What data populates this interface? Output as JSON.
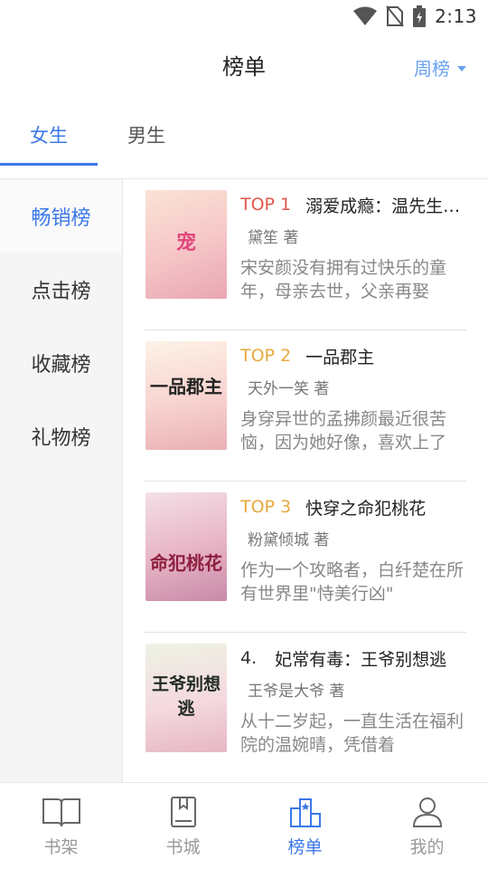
{
  "status": {
    "time": "2:13"
  },
  "header": {
    "title": "榜单",
    "period": "周榜"
  },
  "gender_tabs": [
    {
      "label": "女生",
      "active": true
    },
    {
      "label": "男生",
      "active": false
    }
  ],
  "categories": [
    {
      "label": "畅销榜",
      "active": true
    },
    {
      "label": "点击榜",
      "active": false
    },
    {
      "label": "收藏榜",
      "active": false
    },
    {
      "label": "礼物榜",
      "active": false
    }
  ],
  "books": [
    {
      "rank": "TOP 1",
      "title": "溺爱成瘾：温先生的独宠",
      "author": "黛笙 著",
      "desc": "宋安颜没有拥有过快乐的童年，母亲去世，父亲再娶",
      "cover_text": "宠"
    },
    {
      "rank": "TOP 2",
      "title": "一品郡主",
      "author": "天外一笑 著",
      "desc": "身穿异世的孟拂颜最近很苦恼，因为她好像，喜欢上了",
      "cover_text": "一品郡主"
    },
    {
      "rank": "TOP 3",
      "title": "快穿之命犯桃花",
      "author": "粉黛倾城 著",
      "desc": "作为一个攻略者，白纤楚在所有世界里\"恃美行凶\"",
      "cover_text": "命犯桃花"
    },
    {
      "rank": "4.",
      "title": "妃常有毒：王爷别想逃",
      "author": "王爷是大爷 著",
      "desc": "从十二岁起，一直生活在福利院的温婉晴，凭借着",
      "cover_text": "王爷别想逃"
    }
  ],
  "bottom_nav": [
    {
      "label": "书架",
      "icon": "book-open-icon",
      "active": false
    },
    {
      "label": "书城",
      "icon": "bookmark-book-icon",
      "active": false
    },
    {
      "label": "榜单",
      "icon": "ranking-podium-icon",
      "active": true
    },
    {
      "label": "我的",
      "icon": "user-icon",
      "active": false
    }
  ],
  "colors": {
    "accent": "#3b78e7",
    "top1": "#e2574c",
    "top23": "#e8a93e",
    "period": "#6aa3f0"
  }
}
